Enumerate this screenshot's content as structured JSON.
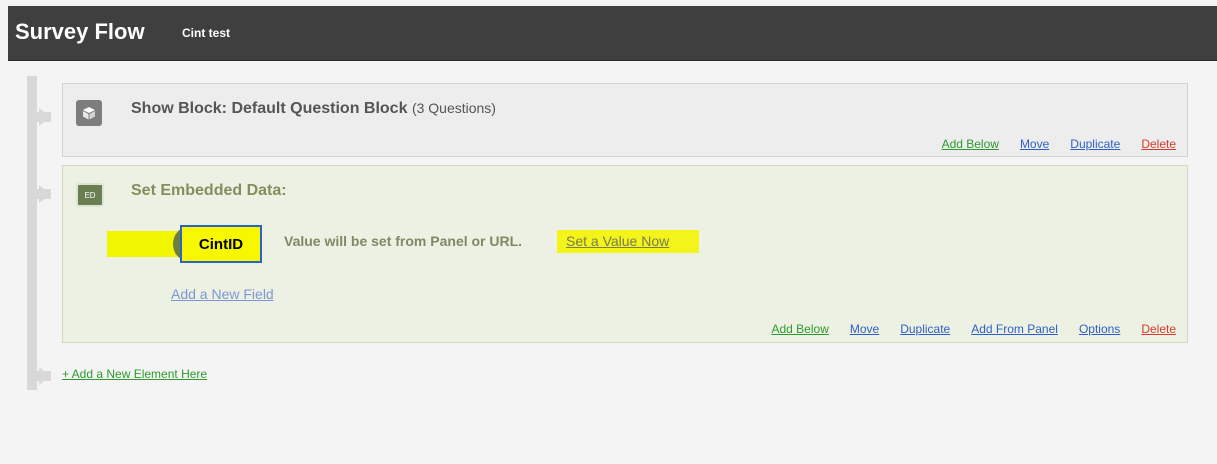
{
  "header": {
    "title": "Survey Flow",
    "subtitle": "Cint test"
  },
  "block": {
    "title": "Show Block: Default Question Block",
    "count": "(3 Questions)",
    "icon": "cube-icon",
    "actions": [
      {
        "label": "Add Below",
        "color": "#2d9a2d"
      },
      {
        "label": "Move",
        "color": "#2f5fc4"
      },
      {
        "label": "Duplicate",
        "color": "#2f5fc4"
      },
      {
        "label": "Delete",
        "color": "#d93a2b"
      }
    ]
  },
  "embedded": {
    "icon_label": "ED",
    "title": "Set Embedded Data:",
    "field_name": "CintID",
    "field_text": "Value will be set from Panel or URL.",
    "set_value_link": "Set a Value Now",
    "add_field_link": "Add a New Field",
    "actions": [
      {
        "label": "Add Below",
        "color": "#2d9a2d"
      },
      {
        "label": "Move",
        "color": "#2f5fc4"
      },
      {
        "label": "Duplicate",
        "color": "#2f5fc4"
      },
      {
        "label": "Add From Panel",
        "color": "#2f5fc4"
      },
      {
        "label": "Options",
        "color": "#2f5fc4"
      },
      {
        "label": "Delete",
        "color": "#d93a2b"
      }
    ]
  },
  "add_element_link": "+ Add a New Element Here"
}
